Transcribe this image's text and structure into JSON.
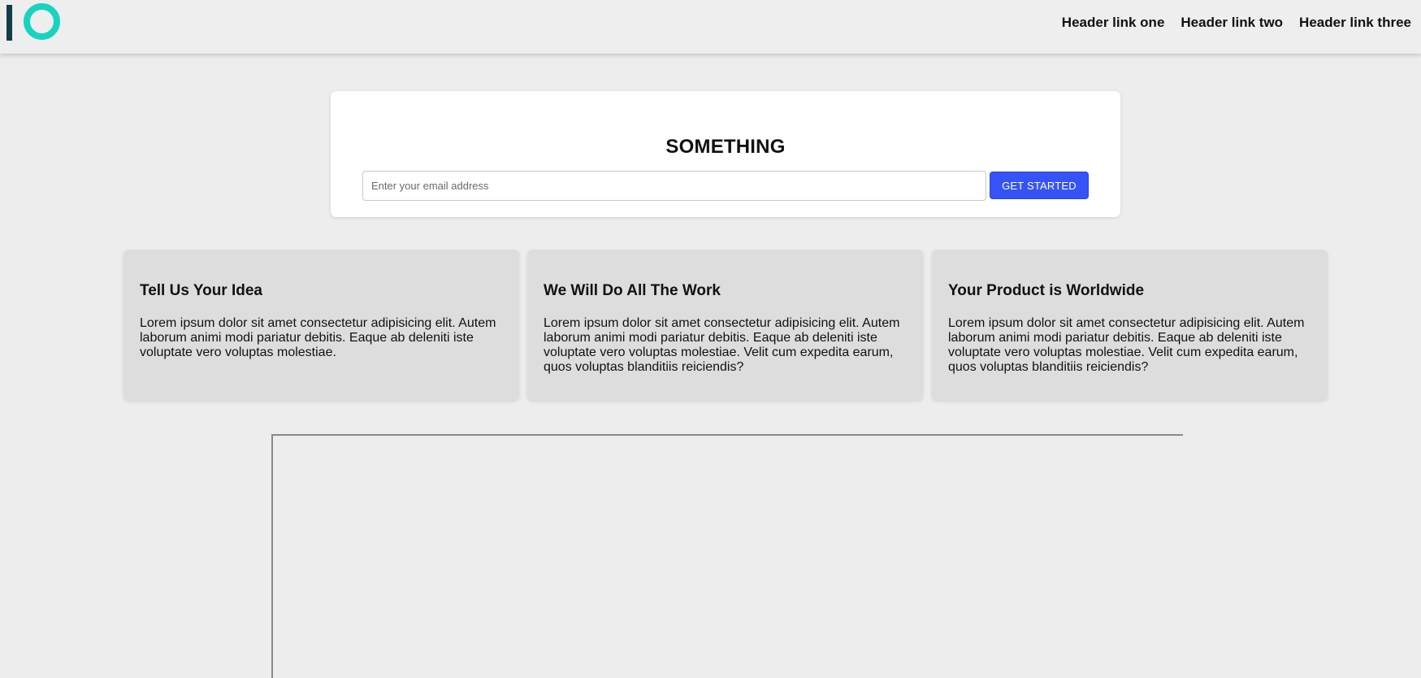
{
  "header": {
    "links": [
      {
        "label": "Header link one"
      },
      {
        "label": "Header link two"
      },
      {
        "label": "Header link three"
      }
    ]
  },
  "signup": {
    "title": "SOMETHING",
    "email_placeholder": "Enter your email address",
    "email_value": "",
    "button_label": "GET STARTED"
  },
  "features": [
    {
      "title": "Tell Us Your Idea",
      "text": "Lorem ipsum dolor sit amet consectetur adipisicing elit. Autem laborum animi modi pariatur debitis. Eaque ab deleniti iste voluptate vero voluptas molestiae."
    },
    {
      "title": "We Will Do All The Work",
      "text": "Lorem ipsum dolor sit amet consectetur adipisicing elit. Autem laborum animi modi pariatur debitis. Eaque ab deleniti iste voluptate vero voluptas molestiae. Velit cum expedita earum, quos voluptas blanditiis reiciendis?"
    },
    {
      "title": "Your Product is Worldwide",
      "text": "Lorem ipsum dolor sit amet consectetur adipisicing elit. Autem laborum animi modi pariatur debitis. Eaque ab deleniti iste voluptate vero voluptas molestiae. Velit cum expedita earum, quos voluptas blanditiis reiciendis?"
    }
  ],
  "colors": {
    "page_background": "#ededed",
    "logo_bar": "#133c47",
    "logo_ring": "#18d3c0",
    "button": "#3653f7",
    "feature_card": "#dddddd"
  },
  "icons": {
    "logo": "io-logo-icon"
  }
}
